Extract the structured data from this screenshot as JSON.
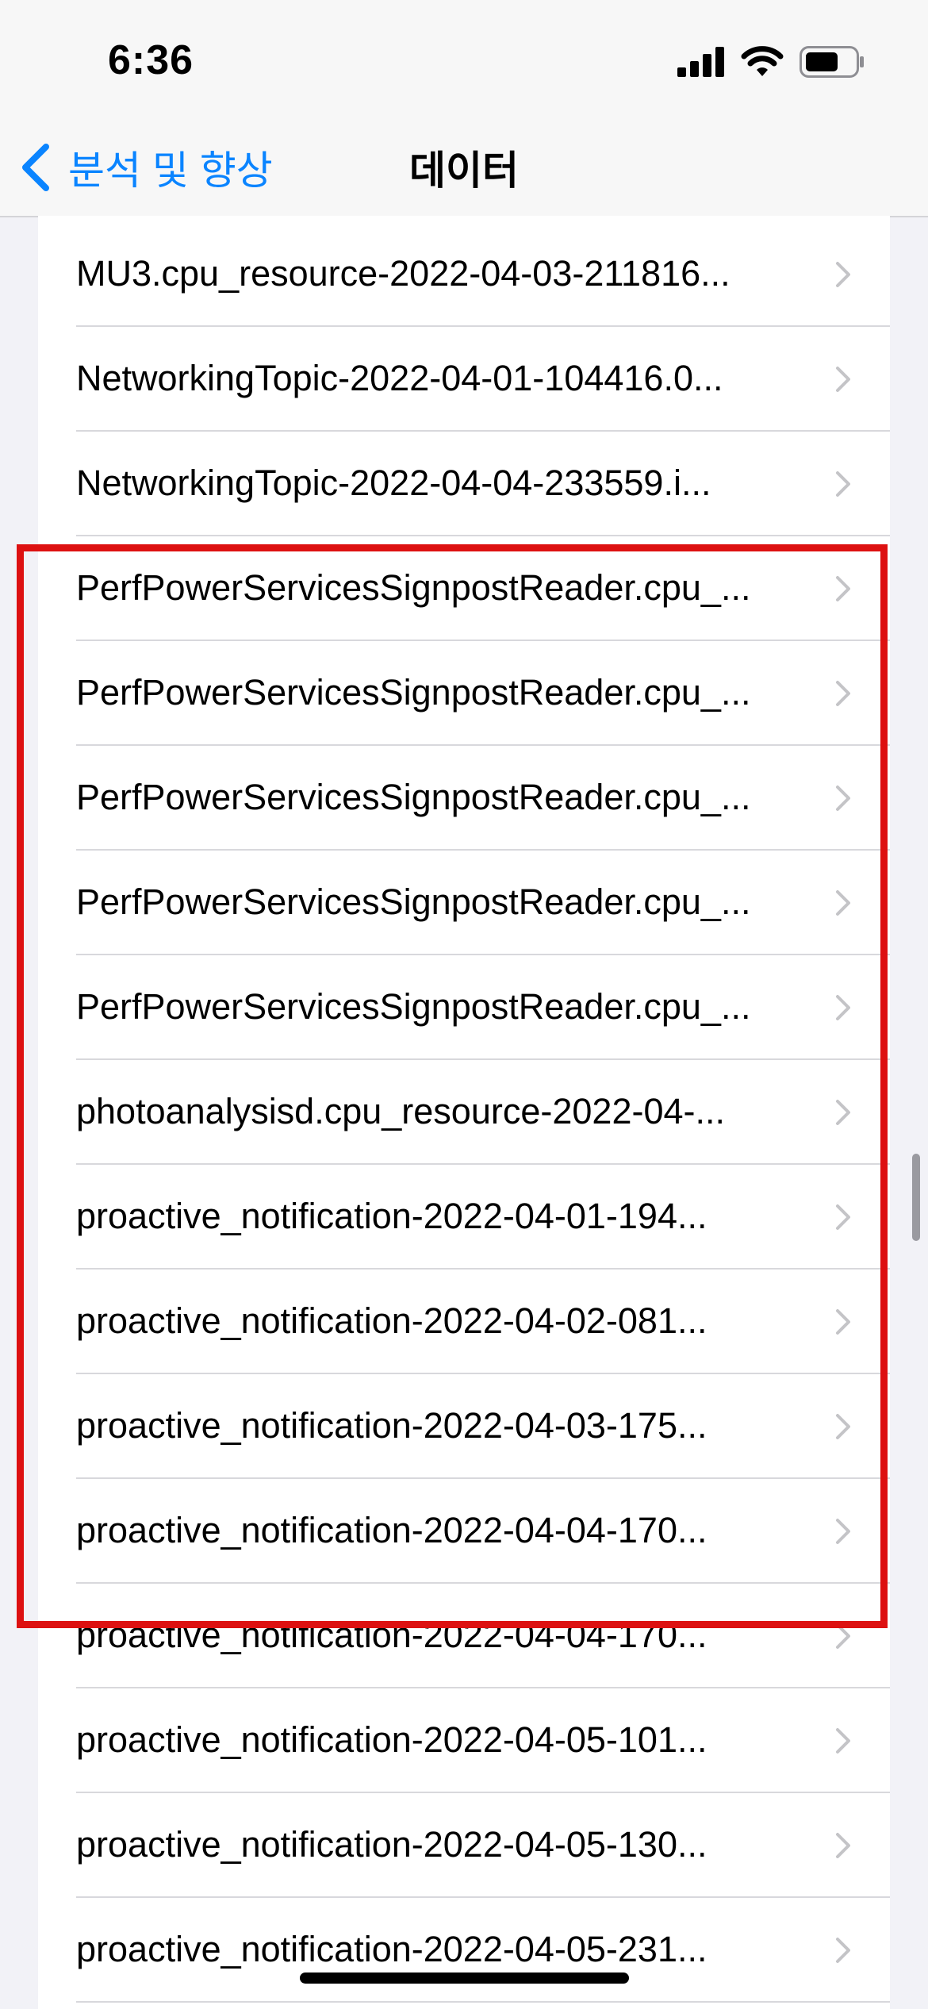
{
  "status_bar": {
    "time": "6:36",
    "icons": [
      "cellular-signal-icon",
      "wifi-icon",
      "battery-icon"
    ]
  },
  "nav": {
    "back_label": "분석 및 향상",
    "title": "데이터",
    "accent_color": "#0a84ff"
  },
  "highlight_color": "#dd1111",
  "rows": [
    "MU3.cpu_resource-2022-04-03-211816...",
    "NetworkingTopic-2022-04-01-104416.0...",
    "NetworkingTopic-2022-04-04-233559.i...",
    "PerfPowerServicesSignpostReader.cpu_...",
    "PerfPowerServicesSignpostReader.cpu_...",
    "PerfPowerServicesSignpostReader.cpu_...",
    "PerfPowerServicesSignpostReader.cpu_...",
    "PerfPowerServicesSignpostReader.cpu_...",
    "photoanalysisd.cpu_resource-2022-04-...",
    "proactive_notification-2022-04-01-194...",
    "proactive_notification-2022-04-02-081...",
    "proactive_notification-2022-04-03-175...",
    "proactive_notification-2022-04-04-170...",
    "proactive_notification-2022-04-04-170...",
    "proactive_notification-2022-04-05-101...",
    "proactive_notification-2022-04-05-130...",
    "proactive_notification-2022-04-05-231..."
  ]
}
